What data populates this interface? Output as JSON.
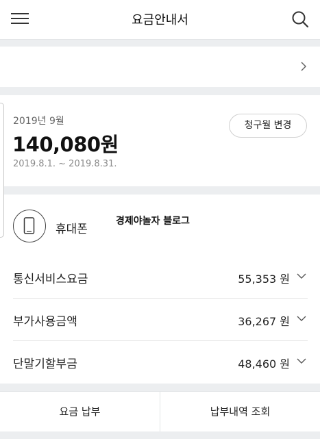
{
  "header": {
    "title": "요금안내서",
    "menu_icon": "hamburger-menu-icon",
    "search_icon": "search-icon"
  },
  "summary": {
    "month": "2019년 9월",
    "amount": "140,080원",
    "period": "2019.8.1. ~ 2019.8.31.",
    "change_button": "청구월 변경"
  },
  "device": {
    "label": "휴대폰",
    "icon": "smartphone-icon"
  },
  "watermark": "경제야놀자 블로그",
  "rows": [
    {
      "label": "통신서비스요금",
      "value": "55,353 원"
    },
    {
      "label": "부가사용금액",
      "value": "36,267 원"
    },
    {
      "label": "단말기할부금",
      "value": "48,460 원"
    }
  ],
  "bottom": {
    "pay_button": "요금 납부",
    "history_button": "납부내역 조회"
  }
}
